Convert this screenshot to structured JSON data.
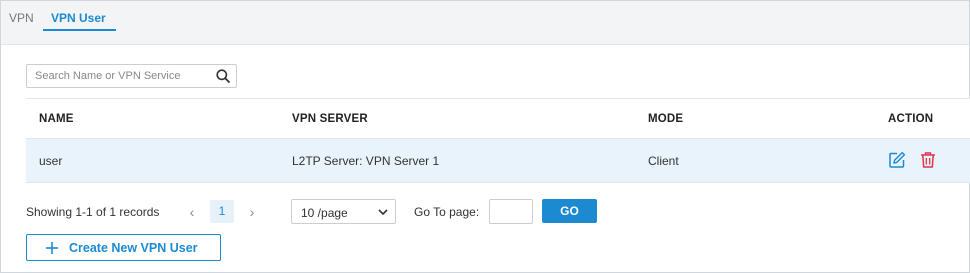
{
  "tabs": [
    {
      "label": "VPN",
      "active": false
    },
    {
      "label": "VPN User",
      "active": true
    }
  ],
  "search": {
    "placeholder": "Search Name or VPN Service",
    "value": "",
    "icon": "search-icon"
  },
  "table": {
    "columns": [
      "NAME",
      "VPN SERVER",
      "MODE",
      "ACTION"
    ],
    "rows": [
      {
        "name": "user",
        "vpn_server": "L2TP Server: VPN Server 1",
        "mode": "Client",
        "actions": [
          "edit-icon",
          "delete-icon"
        ]
      }
    ]
  },
  "pagination": {
    "records_text": "Showing 1-1 of 1 records",
    "prev": "‹",
    "current_page": "1",
    "next": "›",
    "per_page": "10 /page",
    "goto_label": "Go To page:",
    "goto_value": "",
    "go_label": "GO"
  },
  "create_button": {
    "label": "Create New VPN User",
    "icon": "plus-icon"
  },
  "colors": {
    "accent": "#1b8ad1",
    "row_highlight": "#e9f3fb",
    "delete": "#e0314b",
    "tabbar_bg": "#f3f4f6"
  }
}
